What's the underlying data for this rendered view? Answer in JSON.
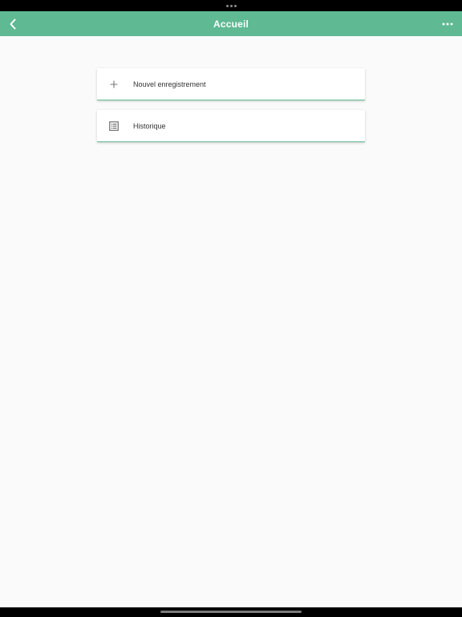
{
  "header": {
    "title": "Accueil",
    "accent_color": "#5fb992"
  },
  "menu": {
    "items": [
      {
        "label": "Nouvel enregistrement",
        "icon": "plus-icon"
      },
      {
        "label": "Historique",
        "icon": "list-document-icon"
      }
    ]
  }
}
